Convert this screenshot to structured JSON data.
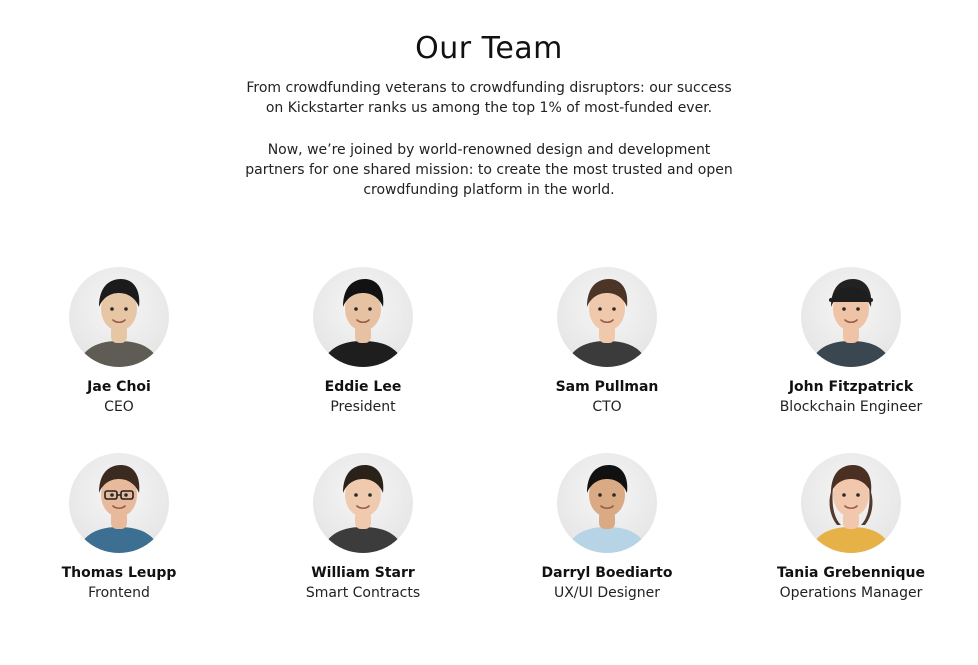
{
  "page": {
    "title": "Our Team",
    "intro": [
      "From crowdfunding veterans to crowdfunding disruptors: our success on Kickstarter ranks us among the top 1% of most-funded ever.",
      "Now, we’re joined by world-renowned design and development partners for one shared mission: to create the most trusted and open crowdfunding platform in the world."
    ]
  },
  "team": [
    {
      "name": "Jae Choi",
      "role": "CEO",
      "photo": "portrait-photo",
      "palette": {
        "skin": "#e7c6a5",
        "hair": "#1b1b1b",
        "shirt": "#5f5b55"
      }
    },
    {
      "name": "Eddie Lee",
      "role": "President",
      "photo": "portrait-photo",
      "palette": {
        "skin": "#e6c2a2",
        "hair": "#121212",
        "shirt": "#1e1e1e"
      }
    },
    {
      "name": "Sam Pullman",
      "role": "CTO",
      "photo": "portrait-photo",
      "palette": {
        "skin": "#f0c8ac",
        "hair": "#4b3526",
        "shirt": "#3b3b3b"
      }
    },
    {
      "name": "John Fitzpatrick",
      "role": "Blockchain Engineer",
      "photo": "portrait-photo",
      "palette": {
        "skin": "#eec3a6",
        "hair": "#222222",
        "shirt": "#3a4650"
      }
    },
    {
      "name": "Thomas Leupp",
      "role": "Frontend",
      "photo": "portrait-photo",
      "palette": {
        "skin": "#e8b99a",
        "hair": "#3b2a20",
        "shirt": "#3d6f93"
      }
    },
    {
      "name": "William Starr",
      "role": "Smart Contracts",
      "photo": "portrait-photo",
      "palette": {
        "skin": "#efcaae",
        "hair": "#2a2119",
        "shirt": "#3c3c3c"
      }
    },
    {
      "name": "Darryl Boediarto",
      "role": "UX/UI Designer",
      "photo": "portrait-photo",
      "palette": {
        "skin": "#d9aa83",
        "hair": "#111111",
        "shirt": "#b7d3e6"
      }
    },
    {
      "name": "Tania Grebennique",
      "role": "Operations Manager",
      "photo": "portrait-photo",
      "palette": {
        "skin": "#f1c7ad",
        "hair": "#4a2f22",
        "shirt": "#e6b248"
      }
    }
  ]
}
